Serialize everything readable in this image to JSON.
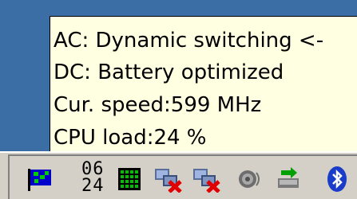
{
  "tooltip": {
    "lines": [
      "AC: Dynamic switching <-",
      "DC: Battery optimized",
      "Cur. speed:599 MHz",
      "CPU load:24 %"
    ]
  },
  "tray": {
    "date_top": "06",
    "date_bottom": "24",
    "icons": [
      "flag-icon",
      "calendar-date-icon",
      "cpu-meter-icon",
      "network-disconnected-icon",
      "network-disconnected-icon",
      "volume-icon",
      "safely-remove-hardware-icon",
      "bluetooth-icon"
    ]
  },
  "colors": {
    "tooltip_bg": "#ffffe1",
    "desktop": "#3a6ea5",
    "taskbar": "#d4d0c8"
  }
}
